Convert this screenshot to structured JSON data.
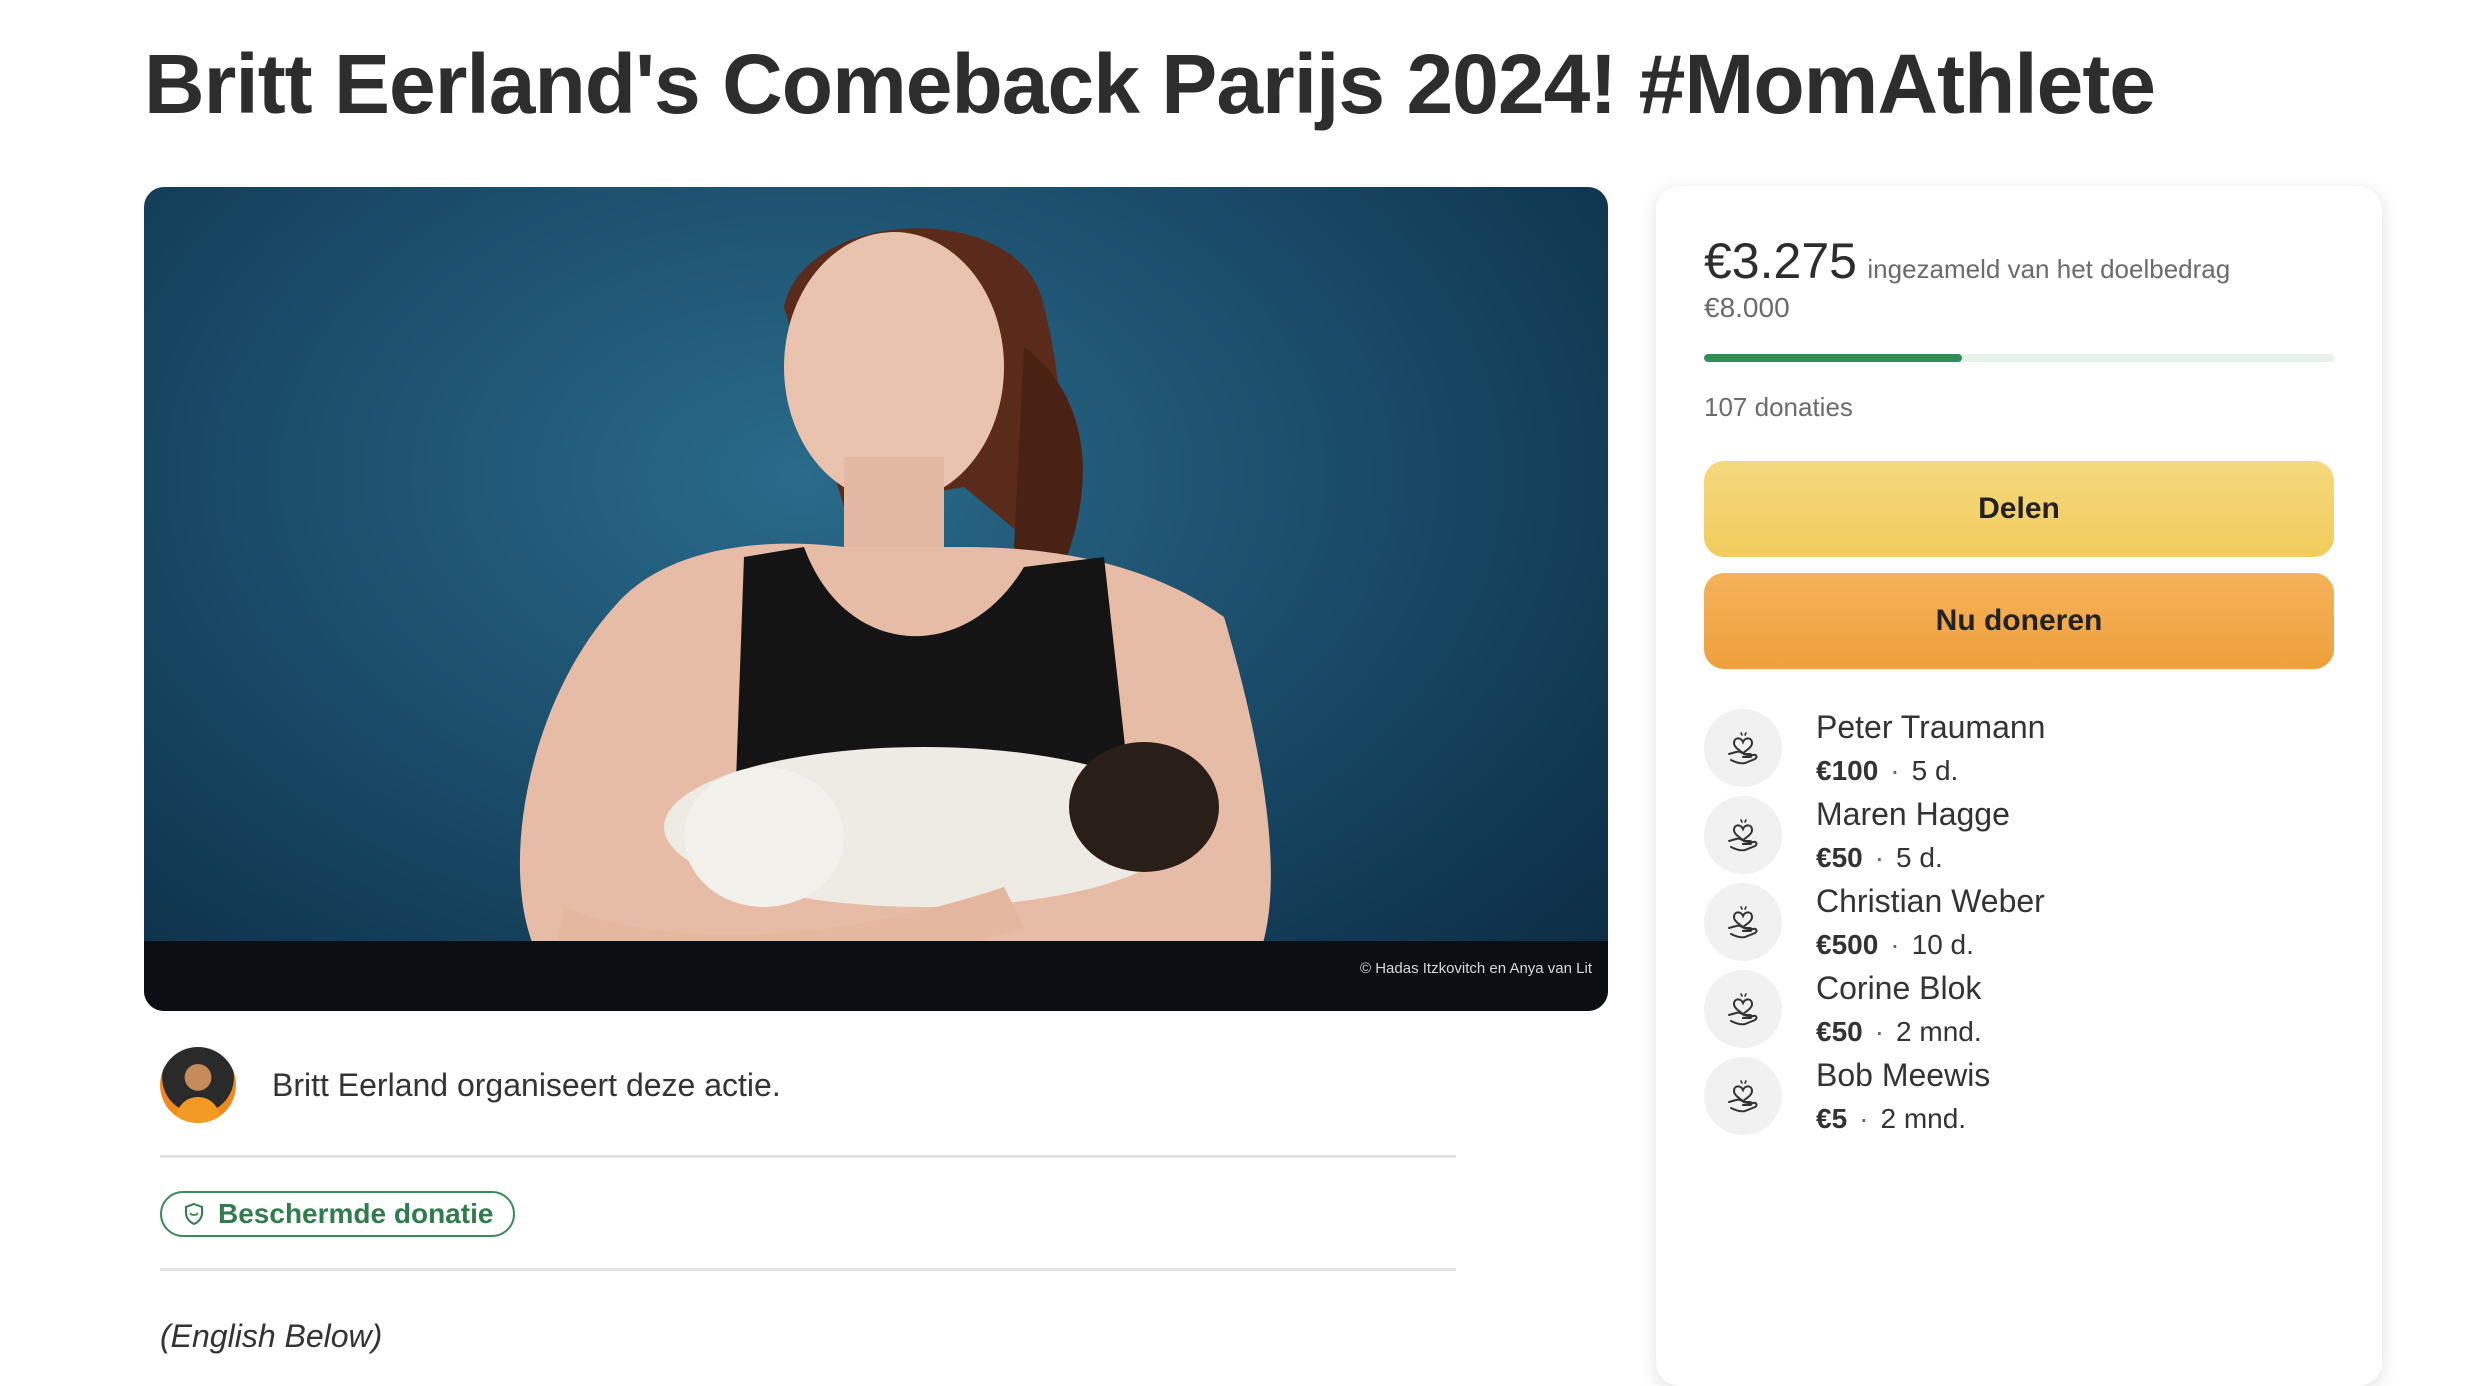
{
  "page": {
    "title": "Britt Eerland's Comeback Parijs 2024! #MomAthlete"
  },
  "hero": {
    "credit": "© Hadas Itzkovitch en Anya van Lit"
  },
  "organizer": {
    "text": "Britt Eerland organiseert deze actie."
  },
  "badge": {
    "label": "Beschermde donatie"
  },
  "story": {
    "intro": "(English Below)"
  },
  "fundraiser": {
    "raised": "€3.275",
    "raised_label": "ingezameld van het doelbedrag",
    "goal": "€8.000",
    "progress_fraction": 0.41,
    "donations_count": "107 donaties",
    "share_label": "Delen",
    "donate_label": "Nu doneren"
  },
  "donors": [
    {
      "name": "Peter Traumann",
      "amount": "€100",
      "time": "5 d."
    },
    {
      "name": "Maren Hagge",
      "amount": "€50",
      "time": "5 d."
    },
    {
      "name": "Christian Weber",
      "amount": "€500",
      "time": "10 d."
    },
    {
      "name": "Corine Blok",
      "amount": "€50",
      "time": "2 mnd."
    },
    {
      "name": "Bob Meewis",
      "amount": "€5",
      "time": "2 mnd."
    }
  ],
  "icons": {
    "donor": "heart-hand-icon",
    "badge": "shield-icon"
  },
  "colors": {
    "accent_green": "#2e8f57",
    "share_button": "#f2cc5c",
    "donate_button": "#efa03c"
  }
}
